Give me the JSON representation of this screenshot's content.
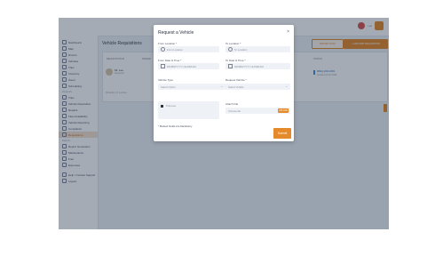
{
  "app": {
    "logo_text": "",
    "user_label": "• •••",
    "accent": "#e58a2b"
  },
  "sidebar": {
    "items_top": [
      {
        "label": "Dashboard"
      },
      {
        "label": "Map"
      },
      {
        "label": "Drivers"
      },
      {
        "label": "Vehicles"
      },
      {
        "label": "Trips"
      },
      {
        "label": "Inventory"
      },
      {
        "label": "Users"
      },
      {
        "label": "Scheduling"
      }
    ],
    "section_requests": "Requests",
    "items_requests": [
      {
        "label": "Trips"
      },
      {
        "label": "Vehicle Requisition"
      },
      {
        "label": "Repairs"
      },
      {
        "label": "Fleet Availability"
      },
      {
        "label": "Vehicle Reporting"
      },
      {
        "label": "Complaints"
      },
      {
        "label": "Requisitions"
      }
    ],
    "section_more": "Reports",
    "items_more": [
      {
        "label": "Report Generation"
      },
      {
        "label": "Maintenance"
      },
      {
        "label": "Fuel"
      },
      {
        "label": "Expenses"
      }
    ],
    "items_bottom": [
      {
        "label": "Help / Contact Support"
      },
      {
        "label": "Logout"
      }
    ]
  },
  "page": {
    "title": "Vehicle Requisitions",
    "btn_export": "EXPORT DATA",
    "btn_new": "+ ADD NEW REQUISITION",
    "columns": [
      "REQUISITION ID",
      "DRIVER"
    ],
    "col_status": "STATUS",
    "row": {
      "name": "Mr. Lee",
      "sub": "Requester",
      "id": "#REQ-2023-0001",
      "date": "Created 23 Oct 2023"
    },
    "footer_note": "Showing 1 of 1 entries"
  },
  "modal": {
    "title": "Request a Vehicle",
    "close": "×",
    "from_label": "From Location *",
    "from_placeholder": "From Location",
    "to_label": "To Location *",
    "to_placeholder": "To Location",
    "from_date_label": "From Date & Time *",
    "from_date_value": "DD/MM/YYYY HH:MM AM",
    "to_date_label": "To Date & Time *",
    "to_date_value": "DD/MM/YYYY HH:MM AM",
    "vehicle_type_label": "Vehicle Type",
    "vehicle_type_value": "Select Option",
    "request_vehicle_label": "Request Vehicle *",
    "request_vehicle_value": "Select Vehicle",
    "purpose_placeholder": "Purpose",
    "attach_label": "Attach File",
    "attach_value": "Choose file",
    "upload_btn": "UPLOAD",
    "mandatory_note": "* Marked Fields Are Mandatory",
    "submit": "Submit"
  }
}
